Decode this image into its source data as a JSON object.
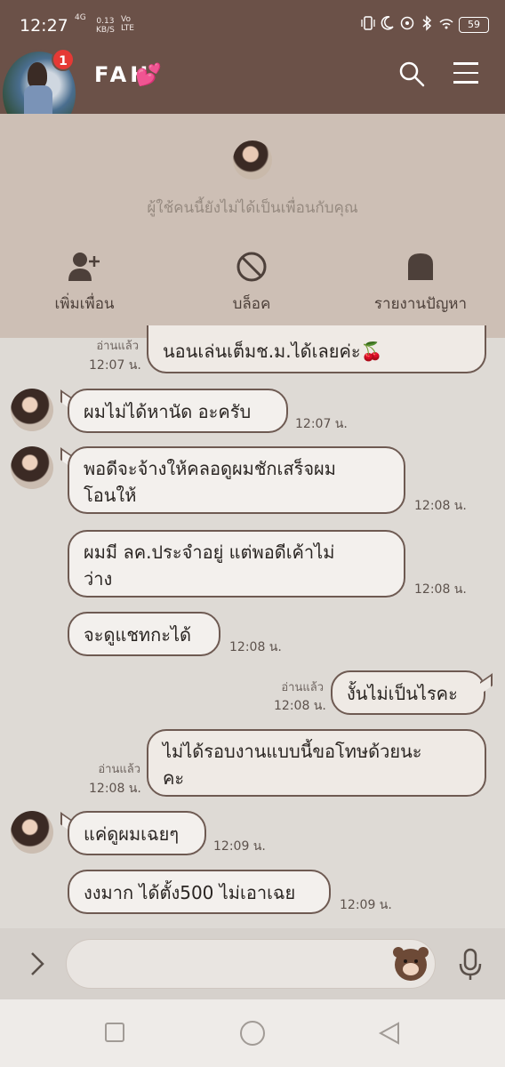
{
  "status_bar": {
    "time": "12:27",
    "network": "4G",
    "speed_value": "0.13",
    "speed_unit": "KB/S",
    "volte_top": "Vo",
    "volte_bottom": "LTE",
    "battery": "59",
    "icons": [
      "vibrate-icon",
      "moon-icon",
      "hotspot-icon",
      "bluetooth-icon",
      "wifi-icon"
    ]
  },
  "header": {
    "contact_name": "FAH",
    "heart": "💕",
    "unread_badge": "1"
  },
  "banner": {
    "note": "ผู้ใช้คนนี้ยังไม่ได้เป็นเพื่อนกับคุณ",
    "actions": [
      {
        "label": "เพิ่มเพื่อน",
        "icon": "add-friend-icon"
      },
      {
        "label": "บล็อค",
        "icon": "block-icon"
      },
      {
        "label": "รายงานปัญหา",
        "icon": "report-icon"
      }
    ]
  },
  "messages": [
    {
      "from": "me",
      "text": "นอนเล่นเต็มช.ม.ได้เลยค่ะ🍒",
      "read": "อ่านแล้ว",
      "time": "12:07 น."
    },
    {
      "from": "them",
      "text": "ผมไม่ได้หานัด อะครับ",
      "time": "12:07 น."
    },
    {
      "from": "them",
      "text": "พอดีจะจ้างให้คลอดูผมชักเสร็จผมโอนให้",
      "line1": "พอดีจะจ้างให้คลอดูผมชักเสร็จผม",
      "line2": "โอนให้",
      "time": "12:08 น."
    },
    {
      "from": "them",
      "line1": "ผมมี ลค.ประจำอยู่ แต่พอดีเค้าไม่",
      "line2": "ว่าง",
      "time": "12:08 น."
    },
    {
      "from": "them",
      "text": "จะดูแชทกะได้",
      "time": "12:08 น."
    },
    {
      "from": "me",
      "text": "งั้นไม่เป็นไรคะ",
      "read": "อ่านแล้ว",
      "time": "12:08 น."
    },
    {
      "from": "me",
      "line1": "ไม่ได้รอบงานแบบนี้ขอโทษด้วยนะ",
      "line2": "คะ",
      "read": "อ่านแล้ว",
      "time": "12:08 น."
    },
    {
      "from": "them",
      "text": "แค่ดูผมเฉยๆ",
      "time": "12:09 น."
    },
    {
      "from": "them",
      "text": "งงมาก ได้ตั้ง500 ไม่เอาเฉย",
      "time": "12:09 น."
    }
  ],
  "input": {
    "placeholder": ""
  },
  "colors": {
    "header_bg": "#6b5148",
    "banner_bg": "#cdbfb5",
    "chat_bg": "#dedad5",
    "bubble_border": "#6e5a52",
    "badge": "#e53935"
  }
}
